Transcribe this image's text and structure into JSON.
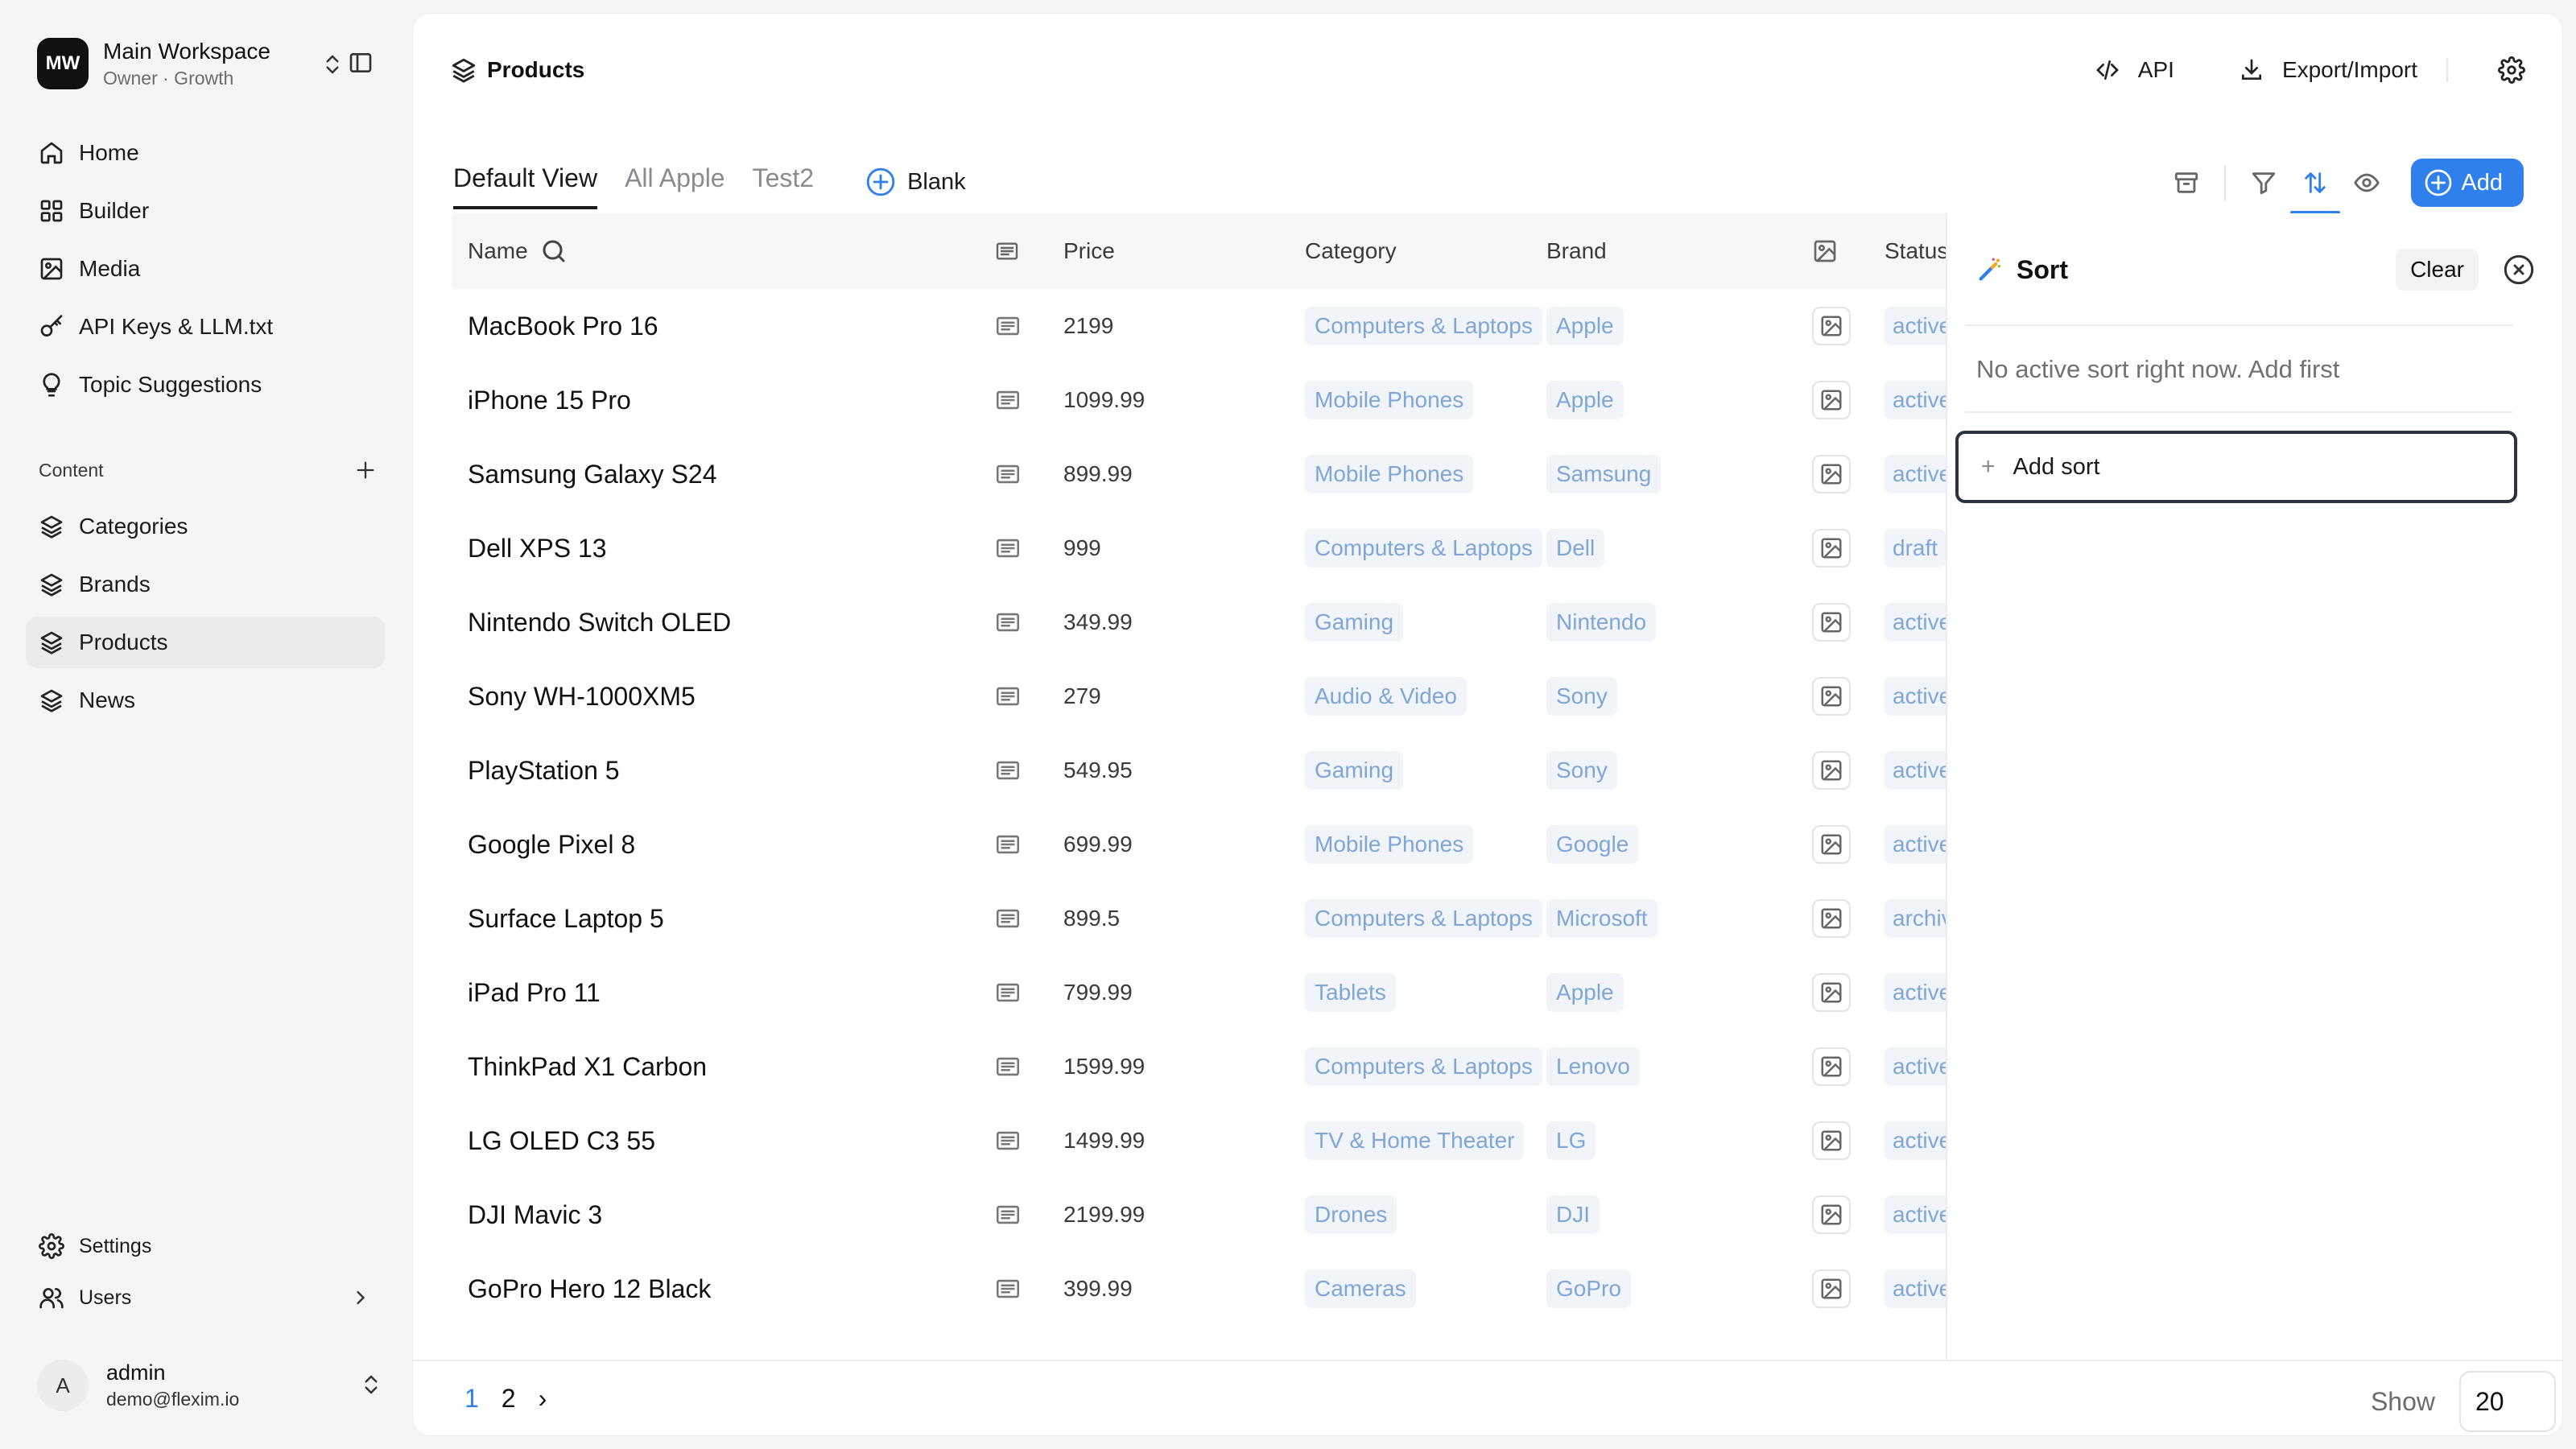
{
  "workspace": {
    "initials": "MW",
    "name": "Main Workspace",
    "subtitle": "Owner · Growth"
  },
  "sidebar": {
    "top_items": [
      {
        "label": "Home",
        "icon": "home-icon"
      },
      {
        "label": "Builder",
        "icon": "grid-icon"
      },
      {
        "label": "Media",
        "icon": "image-icon"
      },
      {
        "label": "API Keys & LLM.txt",
        "icon": "key-icon"
      },
      {
        "label": "Topic Suggestions",
        "icon": "lightbulb-icon"
      }
    ],
    "section_label": "Content",
    "content_items": [
      {
        "label": "Categories",
        "icon": "layers-icon"
      },
      {
        "label": "Brands",
        "icon": "layers-icon"
      },
      {
        "label": "Products",
        "icon": "layers-icon",
        "active": true
      },
      {
        "label": "News",
        "icon": "layers-icon"
      }
    ],
    "bottom_items": [
      {
        "label": "Settings",
        "icon": "gear-icon"
      },
      {
        "label": "Users",
        "icon": "users-icon"
      }
    ],
    "user": {
      "initial": "A",
      "name": "admin",
      "email": "demo@flexim.io"
    }
  },
  "header": {
    "title": "Products",
    "api_label": "API",
    "export_label": "Export/Import"
  },
  "views": {
    "tabs": [
      "Default View",
      "All Apple",
      "Test2"
    ],
    "active_tab": "Default View",
    "blank_label": "Blank",
    "add_label": "Add"
  },
  "table": {
    "columns": {
      "name": "Name",
      "price": "Price",
      "category": "Category",
      "brand": "Brand",
      "status": "Status"
    },
    "rows": [
      {
        "name": "MacBook Pro 16",
        "price": "2199",
        "category": "Computers & Laptops",
        "brand": "Apple",
        "status": "active"
      },
      {
        "name": "iPhone 15 Pro",
        "price": "1099.99",
        "category": "Mobile Phones",
        "brand": "Apple",
        "status": "active"
      },
      {
        "name": "Samsung Galaxy S24",
        "price": "899.99",
        "category": "Mobile Phones",
        "brand": "Samsung",
        "status": "active"
      },
      {
        "name": "Dell XPS 13",
        "price": "999",
        "category": "Computers & Laptops",
        "brand": "Dell",
        "status": "draft"
      },
      {
        "name": "Nintendo Switch OLED",
        "price": "349.99",
        "category": "Gaming",
        "brand": "Nintendo",
        "status": "active"
      },
      {
        "name": "Sony WH-1000XM5",
        "price": "279",
        "category": "Audio & Video",
        "brand": "Sony",
        "status": "active"
      },
      {
        "name": "PlayStation 5",
        "price": "549.95",
        "category": "Gaming",
        "brand": "Sony",
        "status": "active"
      },
      {
        "name": "Google Pixel 8",
        "price": "699.99",
        "category": "Mobile Phones",
        "brand": "Google",
        "status": "active"
      },
      {
        "name": "Surface Laptop 5",
        "price": "899.5",
        "category": "Computers & Laptops",
        "brand": "Microsoft",
        "status": "archived"
      },
      {
        "name": "iPad Pro 11",
        "price": "799.99",
        "category": "Tablets",
        "brand": "Apple",
        "status": "active"
      },
      {
        "name": "ThinkPad X1 Carbon",
        "price": "1599.99",
        "category": "Computers & Laptops",
        "brand": "Lenovo",
        "status": "active"
      },
      {
        "name": "LG OLED C3 55",
        "price": "1499.99",
        "category": "TV & Home Theater",
        "brand": "LG",
        "status": "active"
      },
      {
        "name": "DJI Mavic 3",
        "price": "2199.99",
        "category": "Drones",
        "brand": "DJI",
        "status": "active"
      },
      {
        "name": "GoPro Hero 12 Black",
        "price": "399.99",
        "category": "Cameras",
        "brand": "GoPro",
        "status": "active"
      }
    ]
  },
  "sort_panel": {
    "title": "Sort",
    "clear_label": "Clear",
    "empty_text": "No active sort right now. Add first",
    "add_sort_label": "Add sort"
  },
  "pagination": {
    "pages": [
      "1",
      "2"
    ],
    "current": "1",
    "next": "›",
    "show_label": "Show",
    "page_size": "20"
  },
  "colors": {
    "accent": "#2f80ed",
    "pill_text": "#7fa6d6",
    "pill_bg": "#f1f4f8"
  }
}
